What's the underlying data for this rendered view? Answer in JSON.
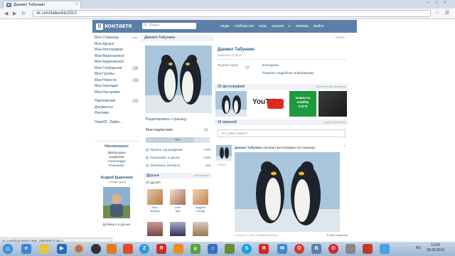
{
  "browser": {
    "tab_title": "Даниил Табункин",
    "favicon_text": "В",
    "close_glyph": "×",
    "url": "vk.com/tabunkin2013",
    "status_url": "vk.com/photo184477865_298009970?all=1",
    "window_controls": [
      "–",
      "□",
      "×"
    ]
  },
  "vk": {
    "logo": "контакте",
    "logo_badge": "В",
    "search_placeholder": "Поиск",
    "top_nav": [
      "люди",
      "сообщества",
      "игры",
      "музыка",
      "помощь",
      "выйти"
    ],
    "left_menu": [
      {
        "label": "Моя Страница",
        "extra": "ред."
      },
      {
        "label": "Мои Друзья",
        "extra": ""
      },
      {
        "label": "Мои Фотографии",
        "extra": ""
      },
      {
        "label": "Мои Видеозаписи",
        "extra": ""
      },
      {
        "label": "Мои Аудиозаписи",
        "extra": ""
      },
      {
        "label": "Мои Сообщения",
        "extra": "+5"
      },
      {
        "label": "Мои Группы",
        "extra": ""
      },
      {
        "label": "Мои Новости",
        "extra": "+3"
      },
      {
        "label": "Мои Закладки",
        "extra": ""
      },
      {
        "label": "Мои Настройки",
        "extra": ""
      }
    ],
    "left_menu_2": [
      {
        "label": "Приложения",
        "extra": "+7"
      },
      {
        "label": "Документы",
        "extra": ""
      },
      {
        "label": "Реклама",
        "extra": ""
      }
    ],
    "left_menu_3": "ПоиобС. Лайкн...",
    "reminder": {
      "title": "Напоминание",
      "line1": "Завтра день",
      "line2": "рождения",
      "line3": "Александра",
      "line4": "Плешкова."
    },
    "friend_suggest": {
      "name": "Андрей Дыренков",
      "mutual": "1 общих друга",
      "add": "Добавить в друзья"
    }
  },
  "profile": {
    "name_bar": "Даниил Табункин",
    "online": "Online",
    "name": "Даниил Табункин",
    "status": "изменить статус",
    "city_label": "Родной город:",
    "city_value": "волгодонск",
    "more_info": "Показать подробную информацию",
    "edit_page": "Редактировать страницу",
    "subscribers_label": "Мои подписчики",
    "subscribers_count": "1",
    "completion": {
      "percent": 75,
      "label": "75%"
    },
    "completion_items": [
      {
        "label": "Указать год рождения",
        "pct": "+10%"
      },
      {
        "label": "Рассказать о школе",
        "pct": "+10%"
      },
      {
        "label": "Заполнить контакты",
        "pct": "+5%"
      }
    ],
    "friends_title": "Друзья",
    "friends_link": "обновления",
    "friends_count": "30 друзей",
    "friends": [
      {
        "name": "Alen",
        "surname": "Bolaluy"
      },
      {
        "name": "Олег",
        "surname": "Бик"
      },
      {
        "name": "Андрей",
        "surname": "Гончар"
      }
    ],
    "photos_title": "20 фотографий",
    "photos_link": "добавить фотографии",
    "youtube_label": "YouTube",
    "quiz_lines": [
      "нажми на",
      "ошибку",
      "2×2=5"
    ],
    "wall_title": "16 записей",
    "wall_link": "записи Даниила",
    "wall_placeholder": "Что у Вас нового?",
    "posts_bar": "Записи Даниила",
    "post": {
      "author": "Даниил Табункин",
      "action": "обновил фотографию на странице:",
      "online": "Online",
      "meta": "25 мар в 12:59 | Комментировать",
      "likes": "♥ Мне нравится"
    }
  },
  "taskbar": {
    "icons": [
      "start",
      "ie",
      "folder",
      "media",
      "chrome",
      "opera",
      "skype",
      "yandex",
      "ok",
      "utorrent",
      "music",
      "skype2",
      "mail",
      "vk",
      "opera2",
      "minecraft",
      "tools"
    ],
    "lang": "RU",
    "time": "12:59",
    "date": "25.03.2013"
  },
  "colors": {
    "vk_blue": "#5b7fa6",
    "link": "#2b587a",
    "header_bg": "#eef2f6"
  }
}
